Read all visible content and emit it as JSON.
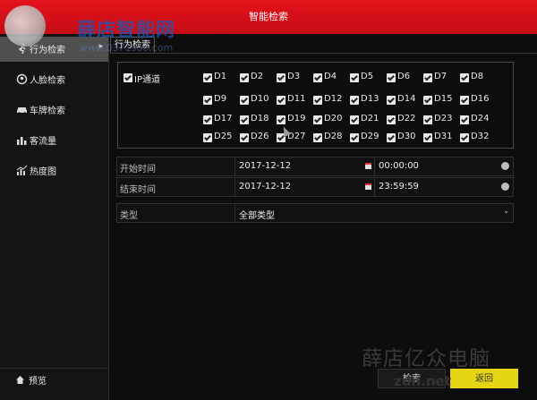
{
  "window": {
    "title": "智能检索"
  },
  "sidebar": {
    "items": [
      {
        "label": "行为检索",
        "icon": "running-person-icon",
        "active": true
      },
      {
        "label": "人脸检索",
        "icon": "face-icon"
      },
      {
        "label": "车牌检索",
        "icon": "car-icon"
      },
      {
        "label": "客流量",
        "icon": "people-counting-icon"
      },
      {
        "label": "热度图",
        "icon": "bar-chart-icon"
      }
    ],
    "preview": {
      "label": "预览",
      "icon": "home-icon"
    }
  },
  "tab": {
    "label": "行为检索"
  },
  "channels": {
    "ip_label": "IP通道",
    "list": [
      "D1",
      "D2",
      "D3",
      "D4",
      "D5",
      "D6",
      "D7",
      "D8",
      "D9",
      "D10",
      "D11",
      "D12",
      "D13",
      "D14",
      "D15",
      "D16",
      "D17",
      "D18",
      "D19",
      "D20",
      "D21",
      "D22",
      "D23",
      "D24",
      "D25",
      "D26",
      "D27",
      "D28",
      "D29",
      "D30",
      "D31",
      "D32"
    ]
  },
  "form": {
    "start": {
      "label": "开始时间",
      "date": "2017-12-12",
      "time": "00:00:00"
    },
    "end": {
      "label": "结束时间",
      "date": "2017-12-12",
      "time": "23:59:59"
    },
    "type": {
      "label": "类型",
      "value": "全部类型"
    }
  },
  "buttons": {
    "search": "检索",
    "back": "返回"
  },
  "watermark": {
    "title": "薛店智能网",
    "url": "www.0371s60.com",
    "bottom": "薛店亿众电脑",
    "bottom_url": "zdn.net"
  },
  "colors": {
    "titlebar": "#d4111a",
    "accent": "#e6d515",
    "background": "#0d0d0d"
  }
}
